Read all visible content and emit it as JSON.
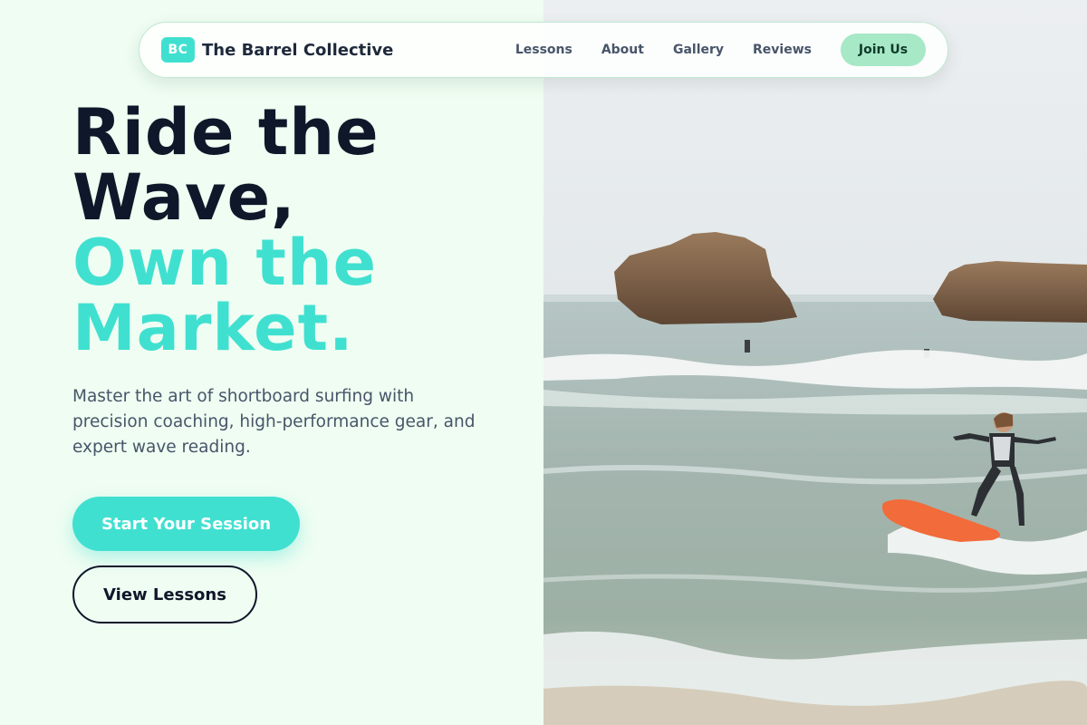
{
  "nav": {
    "brand_badge": "BC",
    "brand_name": "The Barrel Collective",
    "links": [
      "Lessons",
      "About",
      "Gallery",
      "Reviews"
    ],
    "cta": "Join Us"
  },
  "hero": {
    "headline_line1": "Ride the",
    "headline_line2": "Wave,",
    "headline_accent1": "Own the",
    "headline_accent2": "Market.",
    "subtitle": "Master the art of shortboard surfing with precision coaching, high-performance gear, and expert wave reading.",
    "primary_cta": "Start Your Session",
    "secondary_cta": "View Lessons"
  },
  "colors": {
    "accent": "#40e0d0",
    "dark": "#0f172a",
    "background": "#effdf2",
    "join_button": "#a7e8c6",
    "surfboard": "#f26b3a"
  },
  "image": {
    "icon": "surf-photo"
  }
}
